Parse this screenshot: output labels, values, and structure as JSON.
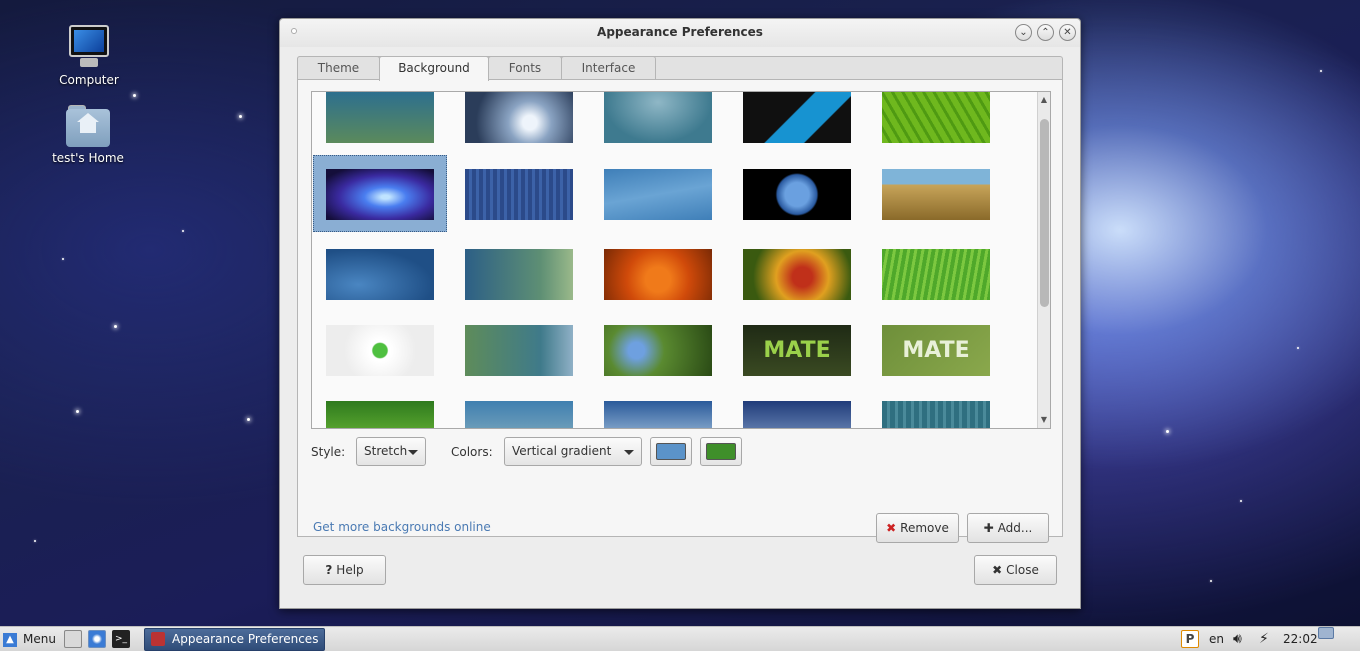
{
  "desktop": {
    "icons": [
      {
        "label": "Computer"
      },
      {
        "label": "test's Home"
      }
    ]
  },
  "window": {
    "title": "Appearance Preferences",
    "controls": {
      "minimize": "⌄",
      "maximize": "⌃",
      "close": "✕"
    }
  },
  "tabs": [
    {
      "label": "Theme"
    },
    {
      "label": "Background"
    },
    {
      "label": "Fonts"
    },
    {
      "label": "Interface"
    }
  ],
  "active_tab": "Background",
  "wallpapers": {
    "selected_index": 5,
    "items": [
      {
        "name": "teal-gradient"
      },
      {
        "name": "water-drop"
      },
      {
        "name": "blue-green-haze"
      },
      {
        "name": "archlinux"
      },
      {
        "name": "green-leaf"
      },
      {
        "name": "blue-aurora"
      },
      {
        "name": "blue-stripes"
      },
      {
        "name": "blue-waves"
      },
      {
        "name": "earth-from-space"
      },
      {
        "name": "grass-shore"
      },
      {
        "name": "blue-bubbles"
      },
      {
        "name": "teal-dots"
      },
      {
        "name": "orange-flower"
      },
      {
        "name": "red-flower"
      },
      {
        "name": "green-grass"
      },
      {
        "name": "mate-logo-white"
      },
      {
        "name": "green-blue-swirl"
      },
      {
        "name": "forget-me-not-ladybug"
      },
      {
        "name": "mate-dark"
      },
      {
        "name": "mate-green"
      },
      {
        "name": "green-plant"
      },
      {
        "name": "blue-teal-wave"
      },
      {
        "name": "sky-gradient"
      },
      {
        "name": "clouds"
      },
      {
        "name": "teal-stripes"
      }
    ]
  },
  "controls": {
    "style_label": "Style:",
    "style_value": "Stretch",
    "colors_label": "Colors:",
    "colors_value": "Vertical gradient",
    "primary_color": "#5b93c9",
    "secondary_color": "#3f8f2a"
  },
  "buttons": {
    "get_more": "Get more backgrounds online",
    "remove": "Remove",
    "add": "Add...",
    "help": "Help",
    "close": "Close"
  },
  "taskbar": {
    "menu": "Menu",
    "task": "Appearance Preferences",
    "keyboard_layout": "en",
    "clock": "22:02"
  }
}
